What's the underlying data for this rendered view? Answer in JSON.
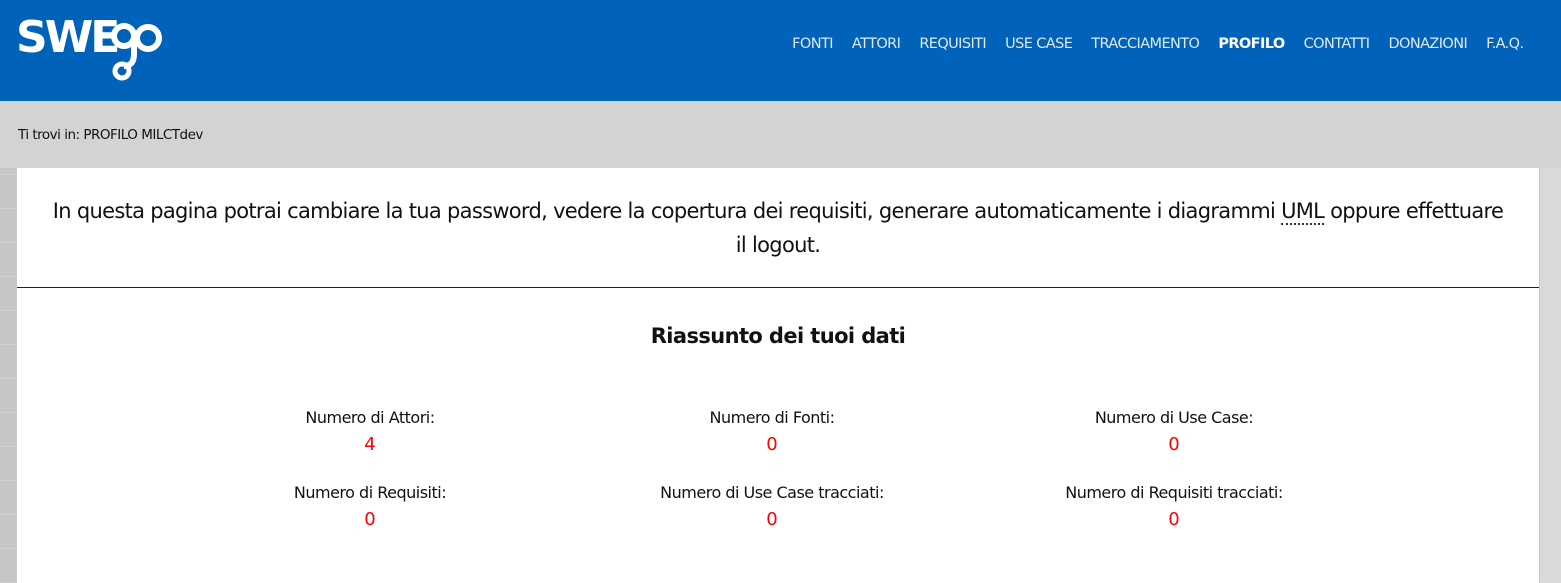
{
  "header": {
    "logo_text": "SWEgo",
    "nav": [
      {
        "label": "FONTI",
        "active": false
      },
      {
        "label": "ATTORI",
        "active": false
      },
      {
        "label": "REQUISITI",
        "active": false
      },
      {
        "label": "USE CASE",
        "active": false
      },
      {
        "label": "TRACCIAMENTO",
        "active": false
      },
      {
        "label": "PROFILO",
        "active": true
      },
      {
        "label": "CONTATTI",
        "active": false
      },
      {
        "label": "DONAZIONI",
        "active": false
      },
      {
        "label": "F.A.Q.",
        "active": false
      }
    ]
  },
  "breadcrumb": {
    "text": "Ti trovi in: PROFILO MILCTdev"
  },
  "intro": {
    "before": "In questa pagina potrai cambiare la tua password, vedere la copertura dei requisiti, generare automaticamente i diagrammi ",
    "abbr": "UML",
    "after": " oppure effettuare il logout."
  },
  "summary": {
    "title": "Riassunto dei tuoi dati",
    "stats": [
      {
        "label": "Numero di Attori:",
        "value": "4"
      },
      {
        "label": "Numero di Fonti:",
        "value": "0"
      },
      {
        "label": "Numero di Use Case:",
        "value": "0"
      },
      {
        "label": "Numero di Requisiti:",
        "value": "0"
      },
      {
        "label": "Numero di Use Case tracciati:",
        "value": "0"
      },
      {
        "label": "Numero di Requisiti tracciati:",
        "value": "0"
      }
    ]
  },
  "colors": {
    "header_bg": "#0062b8",
    "breadcrumb_bg": "#d3d3d3",
    "stat_value": "#ff0000"
  }
}
